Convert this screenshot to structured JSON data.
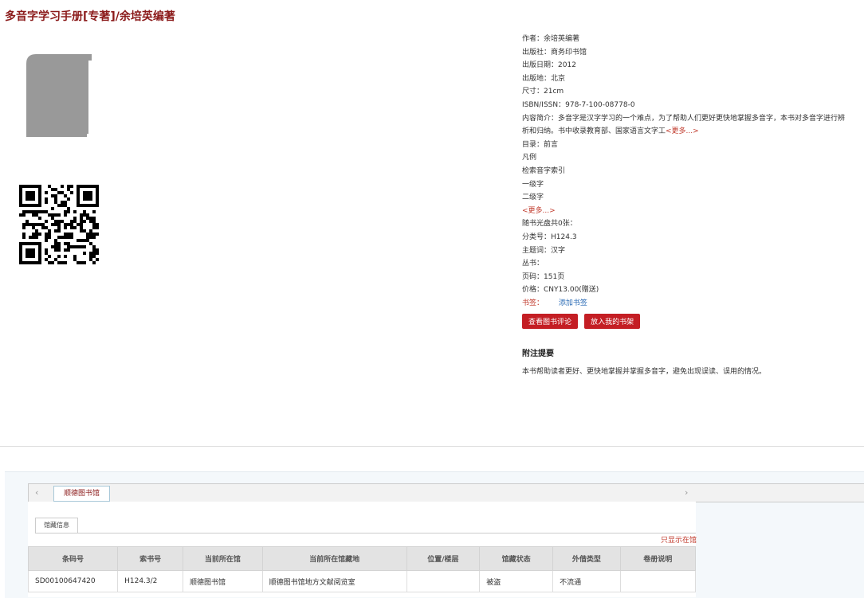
{
  "book": {
    "title": "多音字学习手册[专著]/余培英编著",
    "fields": [
      {
        "label": "作者：",
        "value": "余培英编著"
      },
      {
        "label": "出版社：",
        "value": "商务印书馆"
      },
      {
        "label": "出版日期：",
        "value": "2012"
      },
      {
        "label": "出版地：",
        "value": "北京"
      },
      {
        "label": "尺寸：",
        "value": "21cm"
      },
      {
        "label": "ISBN/ISSN：",
        "value": "978-7-100-08778-0"
      }
    ],
    "summary_label": "内容简介：",
    "summary_text": "多音字是汉字学习的一个难点，为了帮助人们更好更快地掌握多音字，本书对多音字进行辨析和归纳。书中收录教育部、国家语言文字工",
    "more_link": "<更多...>",
    "toc_label": "目录：",
    "toc_items": [
      "前言",
      "凡例",
      "检索音字索引",
      "一级字",
      "二级字"
    ],
    "toc_more": "<更多...>",
    "fields2": [
      {
        "label": "随书光盘共0张：",
        "value": ""
      },
      {
        "label": "分类号：",
        "value": "H124.3"
      },
      {
        "label": "主题词：",
        "value": "汉字"
      },
      {
        "label": "丛书：",
        "value": ""
      },
      {
        "label": "页码：",
        "value": "151页"
      },
      {
        "label": "价格：",
        "value": "CNY13.00(赠送)"
      }
    ],
    "tag_label": "书签：",
    "add_tag": "添加书签",
    "btn_review": "查看图书评论",
    "btn_shelf": "放入我的书架",
    "note_title": "附注提要",
    "note_text": "本书帮助读者更好、更快地掌握并掌握多音字，避免出现误读、误用的情况。"
  },
  "holdings": {
    "library_tab": "顺德图书馆",
    "subtab": "馆藏信息",
    "only_show": "只显示在馆",
    "columns": [
      "条码号",
      "索书号",
      "当前所在馆",
      "当前所在馆藏地",
      "位置/楼层",
      "馆藏状态",
      "外借类型",
      "卷册说明"
    ],
    "rows": [
      [
        "SD00100647420",
        "H124.3/2",
        "顺德图书馆",
        "顺德图书馆地方文献阅览室",
        "",
        "被盗",
        "不流通",
        ""
      ]
    ]
  },
  "icons": {
    "book": "book-icon",
    "qr": "qr-code-icon",
    "prev": "chevron-left-icon",
    "next": "chevron-right-icon"
  }
}
